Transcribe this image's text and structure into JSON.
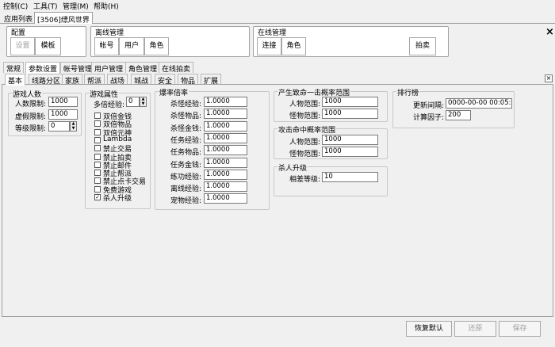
{
  "menu": [
    "控制(C)",
    "工具(T)",
    "管理(M)",
    "帮助(H)"
  ],
  "app_tabs": [
    "应用列表",
    "[3506]缥风世界"
  ],
  "groups": {
    "config": {
      "title": "配置",
      "buttons": [
        "设置",
        "模板"
      ]
    },
    "offline": {
      "title": "离线管理",
      "buttons": [
        "帐号",
        "用户",
        "角色"
      ]
    },
    "online": {
      "title": "在线管理",
      "buttons": [
        "连接",
        "角色",
        "拍卖"
      ]
    }
  },
  "close_glyph": "×",
  "main_tabs": [
    "常规",
    "参数设置",
    "帐号管理",
    "用户管理",
    "角色管理",
    "在线拍卖"
  ],
  "sub_tabs": [
    "基本",
    "线路分区",
    "家族",
    "帮派",
    "战场",
    "城战",
    "安全",
    "物品",
    "扩展"
  ],
  "players": {
    "title": "游戏人数",
    "fields": [
      {
        "label": "人数限制:",
        "value": "1000"
      },
      {
        "label": "虚假限制:",
        "value": "1000"
      },
      {
        "label": "等级限制:",
        "value": "0"
      }
    ]
  },
  "game_attr": {
    "title": "游戏属性",
    "multi_label": "多倍经验:",
    "multi_value": "0",
    "checks": [
      {
        "label": "双倍金钱",
        "checked": false
      },
      {
        "label": "双倍物品",
        "checked": false
      },
      {
        "label": "双倍元神",
        "checked": false
      },
      {
        "label": "Lambda",
        "checked": false
      },
      {
        "label": "禁止交易",
        "checked": false
      },
      {
        "label": "禁止拍卖",
        "checked": false
      },
      {
        "label": "禁止邮件",
        "checked": false
      },
      {
        "label": "禁止帮派",
        "checked": false
      },
      {
        "label": "禁止点卡交易",
        "checked": false
      },
      {
        "label": "免费游戏",
        "checked": false
      },
      {
        "label": "杀人升级",
        "checked": true
      }
    ]
  },
  "rates": {
    "title": "爆率倍率",
    "fields": [
      {
        "label": "杀怪经验:",
        "value": "1.0000"
      },
      {
        "label": "杀怪物品:",
        "value": "1.0000"
      },
      {
        "label": "杀怪金钱:",
        "value": "1.0000"
      },
      {
        "label": "任务经验:",
        "value": "1.0000"
      },
      {
        "label": "任务物品:",
        "value": "1.0000"
      },
      {
        "label": "任务金钱:",
        "value": "1.0000"
      },
      {
        "label": "练功经验:",
        "value": "1.0000"
      },
      {
        "label": "离线经验:",
        "value": "1.0000"
      },
      {
        "label": "宠物经验:",
        "value": "1.0000"
      }
    ]
  },
  "kill_range": {
    "title": "产生致命一击概率范围",
    "fields": [
      {
        "label": "人物范围:",
        "value": "1000"
      },
      {
        "label": "怪物范围:",
        "value": "1000"
      }
    ]
  },
  "hit_range": {
    "title": "攻击命中概率范围",
    "fields": [
      {
        "label": "人物范围:",
        "value": "1000"
      },
      {
        "label": "怪物范围:",
        "value": "1000"
      }
    ]
  },
  "kill_level": {
    "title": "杀人升级",
    "fields": [
      {
        "label": "相差等级:",
        "value": "10"
      }
    ]
  },
  "ranking": {
    "title": "排行榜",
    "fields": [
      {
        "label": "更新间隔:",
        "value": "0000-00-00 00:05:00"
      },
      {
        "label": "计算因子:",
        "value": "200"
      }
    ]
  },
  "footer": {
    "restore": "恢复默认",
    "undo": "还原",
    "save": "保存"
  }
}
